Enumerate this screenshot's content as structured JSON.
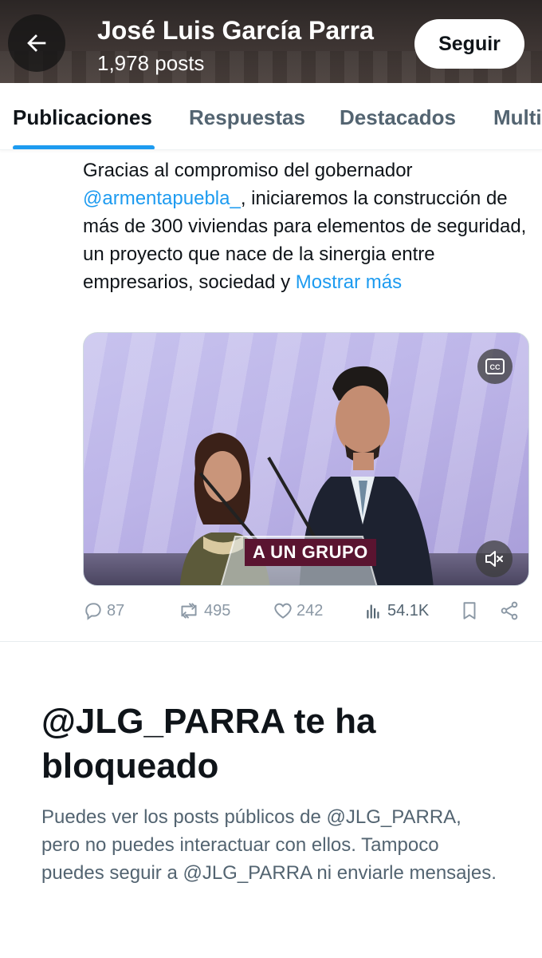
{
  "header": {
    "title": "José Luis García Parra",
    "post_count": "1,978 posts",
    "follow_label": "Seguir"
  },
  "tabs": [
    {
      "label": "Publicaciones",
      "active": true
    },
    {
      "label": "Respuestas",
      "active": false
    },
    {
      "label": "Destacados",
      "active": false
    },
    {
      "label": "Multi",
      "active": false
    }
  ],
  "post": {
    "text_before": "Gracias al compromiso del gobernador ",
    "mention": "@armentapuebla_",
    "text_after": ", iniciaremos la construcción de más de 300 viviendas para elementos de seguridad, un proyecto que nace de la sinergia entre empresarios, sociedad y ",
    "show_more": "Mostrar más",
    "video": {
      "caption": "A UN GRUPO",
      "cc_icon": "closed-captions-icon",
      "mute_icon": "speaker-muted-icon"
    },
    "stats": {
      "replies": "87",
      "reposts": "495",
      "likes": "242",
      "views": "54.1K"
    }
  },
  "blocked": {
    "title": "@JLG_PARRA te ha bloqueado",
    "body": "Puedes ver los posts públicos de @JLG_PARRA, pero no puedes interactuar con ellos. Tampoco puedes seguir a @JLG_PARRA ni enviarle mensajes."
  },
  "colors": {
    "accent": "#1d9bf0",
    "text_primary": "#0f1419",
    "text_secondary": "#536471",
    "caption_bg": "#5a1430"
  }
}
